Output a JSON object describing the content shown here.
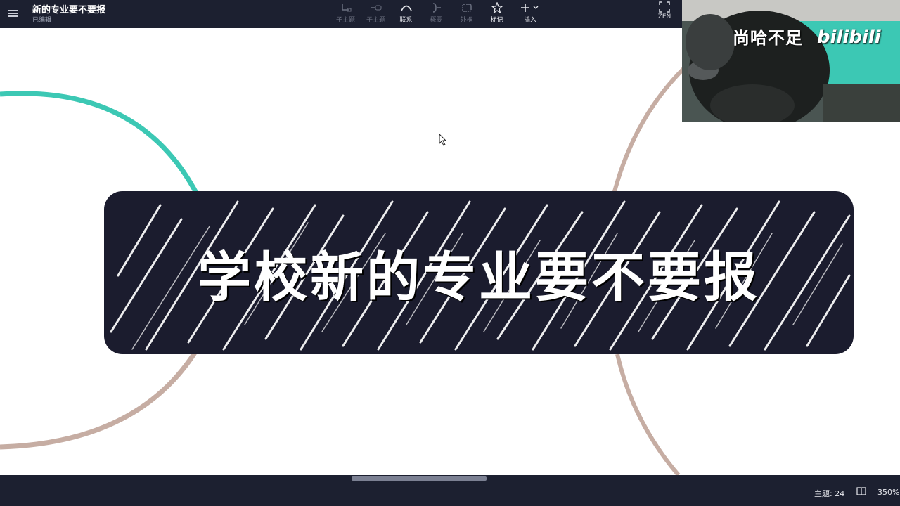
{
  "header": {
    "title": "新的专业要不要报",
    "status": "已编辑"
  },
  "toolbar": {
    "tools": [
      {
        "label": "子主题",
        "icon": "subtopic-icon",
        "enabled": false
      },
      {
        "label": "子主题",
        "icon": "sibling-topic-icon",
        "enabled": false
      },
      {
        "label": "联系",
        "icon": "relationship-icon",
        "enabled": true
      },
      {
        "label": "概要",
        "icon": "summary-icon",
        "enabled": false
      },
      {
        "label": "外框",
        "icon": "boundary-icon",
        "enabled": false
      },
      {
        "label": "标记",
        "icon": "star-icon",
        "enabled": true
      },
      {
        "label": "插入",
        "icon": "plus-icon",
        "enabled": true
      }
    ],
    "zen_label": "ZEN"
  },
  "canvas": {
    "central_topic": "学校新的专业要不要报",
    "colors": {
      "node_background": "#1b1c2e",
      "branch_teal": "#3cc8b4",
      "branch_taupe": "#c6ada3"
    }
  },
  "webcam": {
    "overlay_text": "尚哈不足",
    "logo_text": "bilibili"
  },
  "statusbar": {
    "topic_count": "主题: 24",
    "zoom": "350%"
  }
}
